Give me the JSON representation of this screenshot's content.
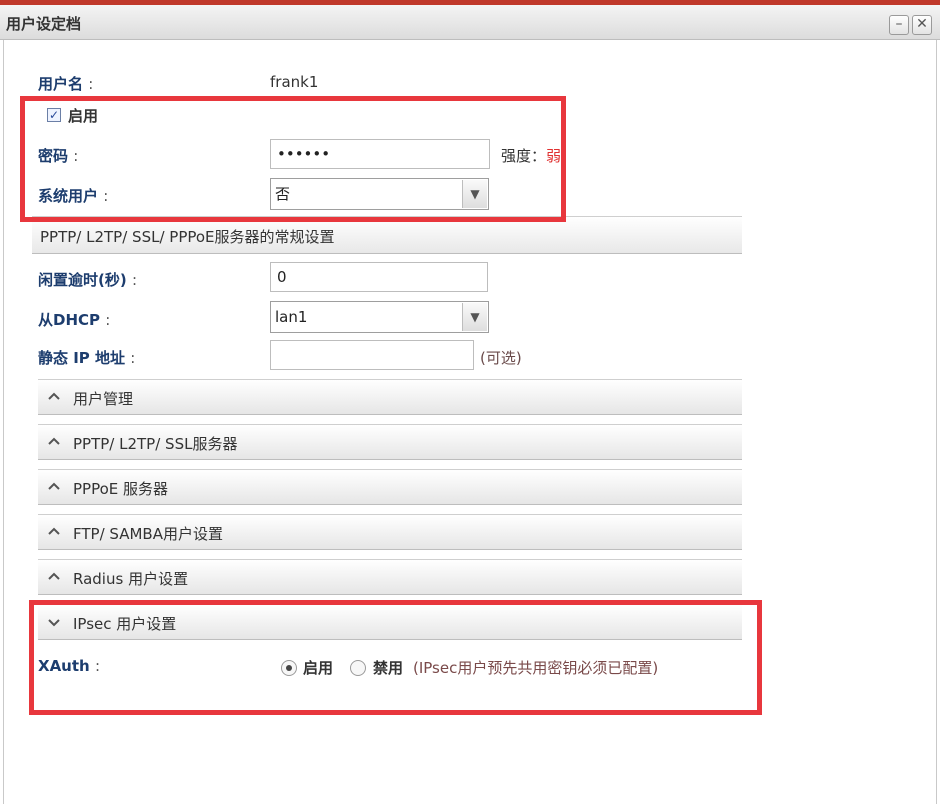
{
  "window": {
    "title": "用户设定档",
    "minimize": "–",
    "close": "✕"
  },
  "form": {
    "username": {
      "label": "用户名",
      "colon": ":",
      "value": "frank1"
    },
    "enable": {
      "label": "启用",
      "checked": true
    },
    "password": {
      "label": "密码",
      "colon": ":",
      "value": "••••••",
      "strength_label": "强度：",
      "strength_value": "弱"
    },
    "system_user": {
      "label": "系统用户",
      "colon": ":",
      "value": "否"
    },
    "general_section": "PPTP/ L2TP/ SSL/ PPPoE服务器的常规设置",
    "idle_timeout": {
      "label": "闲置逾时(秒)",
      "colon": ":",
      "value": "0"
    },
    "from_dhcp": {
      "label": "从DHCP",
      "colon": ":",
      "value": "lan1"
    },
    "static_ip": {
      "label": "静态 IP 地址",
      "colon": ":",
      "value": "",
      "hint": "(可选)"
    }
  },
  "sections": [
    {
      "label": "用户管理",
      "expanded": false
    },
    {
      "label": "PPTP/ L2TP/ SSL服务器",
      "expanded": false
    },
    {
      "label": "PPPoE 服务器",
      "expanded": false
    },
    {
      "label": "FTP/ SAMBA用户设置",
      "expanded": false
    },
    {
      "label": "Radius 用户设置",
      "expanded": false
    },
    {
      "label": "IPsec 用户设置",
      "expanded": true
    }
  ],
  "ipsec": {
    "xauth_label": "XAuth",
    "colon": ":",
    "enable_label": "启用",
    "disable_label": "禁用",
    "selected": "启用",
    "note": "(IPsec用户预先共用密钥必须已配置)"
  },
  "colors": {
    "highlight": "#e8373d",
    "label_blue": "#1d3d6e",
    "top_accent": "#c0392b"
  }
}
